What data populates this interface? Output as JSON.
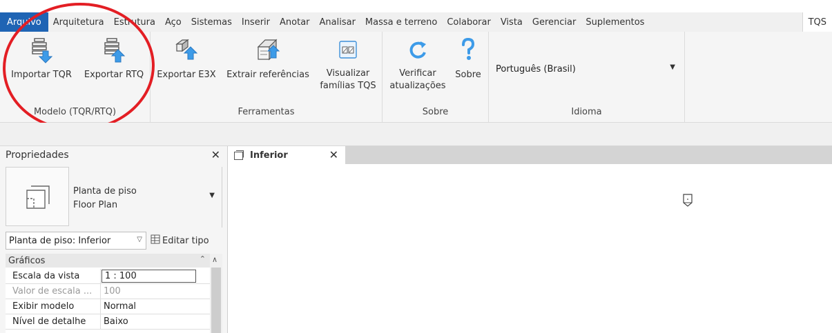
{
  "ribbon_tabs": {
    "file": "Arquivo",
    "architecture": "Arquitetura",
    "structure": "Estrutura",
    "steel": "Aço",
    "systems": "Sistemas",
    "insert": "Inserir",
    "annotate": "Anotar",
    "analyze": "Analisar",
    "massing": "Massa e terreno",
    "collaborate": "Colaborar",
    "view": "Vista",
    "manage": "Gerenciar",
    "addins": "Suplementos",
    "tqs": "TQS"
  },
  "panels": {
    "model": {
      "title": "Modelo (TQR/RTQ)",
      "import_label": "Importar TQR",
      "export_label": "Exportar RTQ"
    },
    "tools": {
      "title": "Ferramentas",
      "export_e3x_label": "Exportar E3X",
      "extract_refs_label": "Extrair referências",
      "view_families_line1": "Visualizar",
      "view_families_line2": "famílias TQS"
    },
    "about": {
      "title": "Sobre",
      "check_updates_line1": "Verificar",
      "check_updates_line2": "atualizações",
      "about_label": "Sobre"
    },
    "language": {
      "title": "Idioma",
      "selected": "Português (Brasil)"
    }
  },
  "properties": {
    "title": "Propriedades",
    "type_name_line1": "Planta de piso",
    "type_name_line2": "Floor Plan",
    "instance_selector": "Planta de piso: Inferior",
    "edit_type_label": "Editar tipo",
    "category": "Gráficos",
    "rows": [
      {
        "name": "Escala da vista",
        "value": "1 : 100"
      },
      {
        "name": "Valor de escala ...",
        "value": "100"
      },
      {
        "name": "Exibir modelo",
        "value": "Normal"
      },
      {
        "name": "Nível de detalhe",
        "value": "Baixo"
      }
    ]
  },
  "view_tab": {
    "label": "Inferior"
  },
  "colors": {
    "file_tab": "#1f64b4",
    "annotation_circle": "#e31e24",
    "icon_blue": "#2f8fe0"
  }
}
